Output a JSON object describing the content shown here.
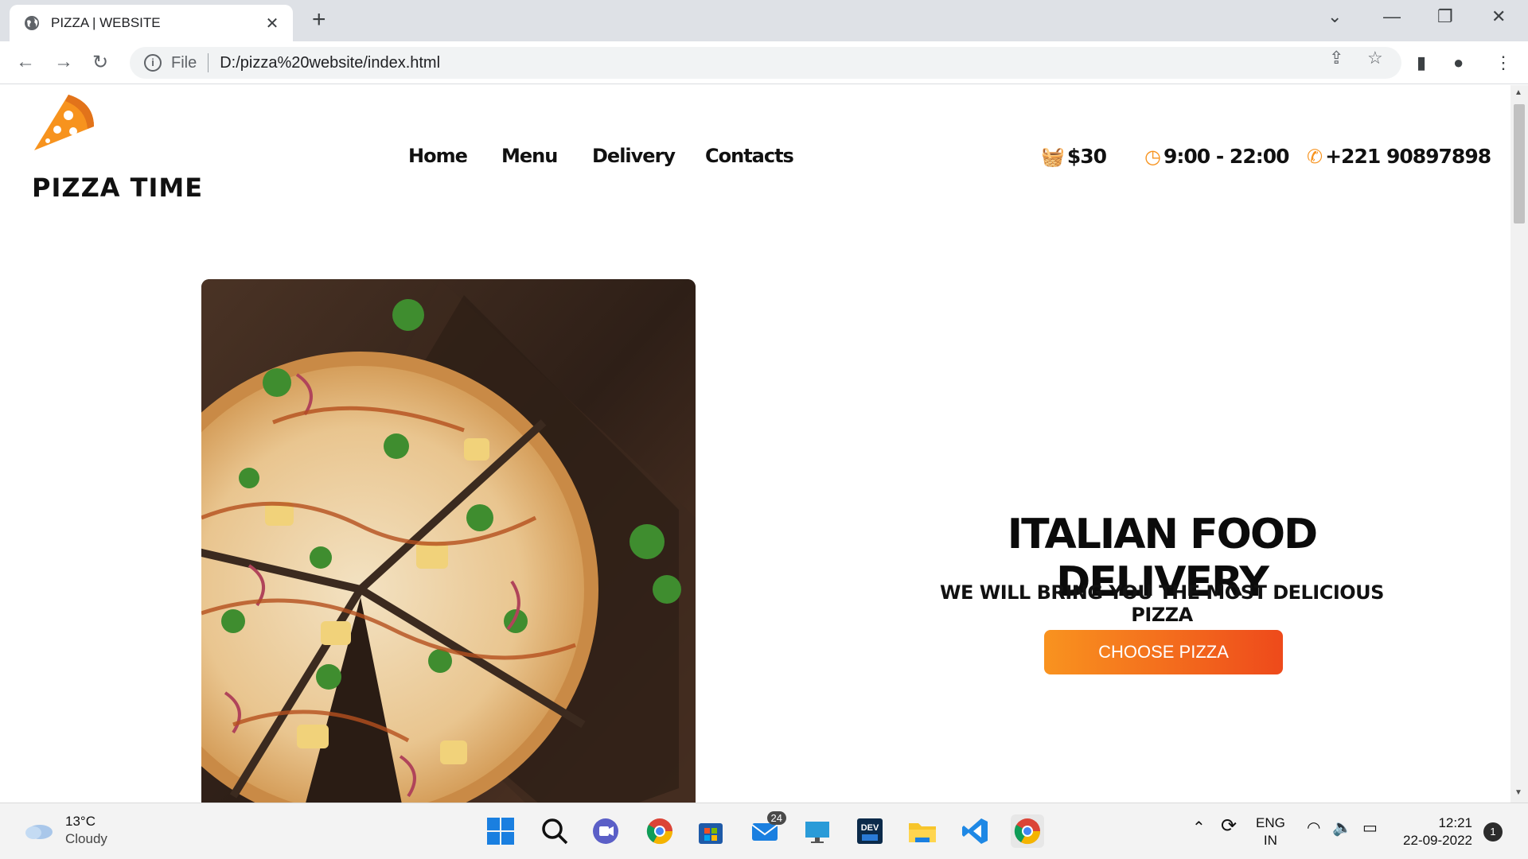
{
  "browser": {
    "tab_title": "PIZZA | WEBSITE",
    "new_tab_symbol": "+",
    "address": {
      "scheme_label": "File",
      "url": "D:/pizza%20website/index.html"
    }
  },
  "site": {
    "brand": "PIZZA TIME",
    "nav": [
      "Home",
      "Menu",
      "Delivery",
      "Contacts"
    ],
    "cart_amount": "$30",
    "hours": "9:00 - 22:00",
    "phone": "+221 90897898",
    "accent_color": "#f7931e",
    "hero": {
      "title": "ITALIAN FOOD DELIVERY",
      "subtitle": "WE WILL BRING YOU THE MOST DELICIOUS PIZZA",
      "cta_label": "CHOOSE PIZZA",
      "image": "pizza-on-wooden-board"
    }
  },
  "taskbar": {
    "weather_temp": "13°C",
    "weather_desc": "Cloudy",
    "mail_badge": "24",
    "lang_top": "ENG",
    "lang_bottom": "IN",
    "time": "12:21",
    "date": "22-09-2022",
    "notifications": "1",
    "apps": [
      "start-icon",
      "search-icon",
      "teams-icon",
      "chrome-icon",
      "store-icon",
      "mail-icon",
      "monitor-icon",
      "dev-icon",
      "folder-icon",
      "vscode-icon",
      "chrome-active-icon"
    ]
  }
}
